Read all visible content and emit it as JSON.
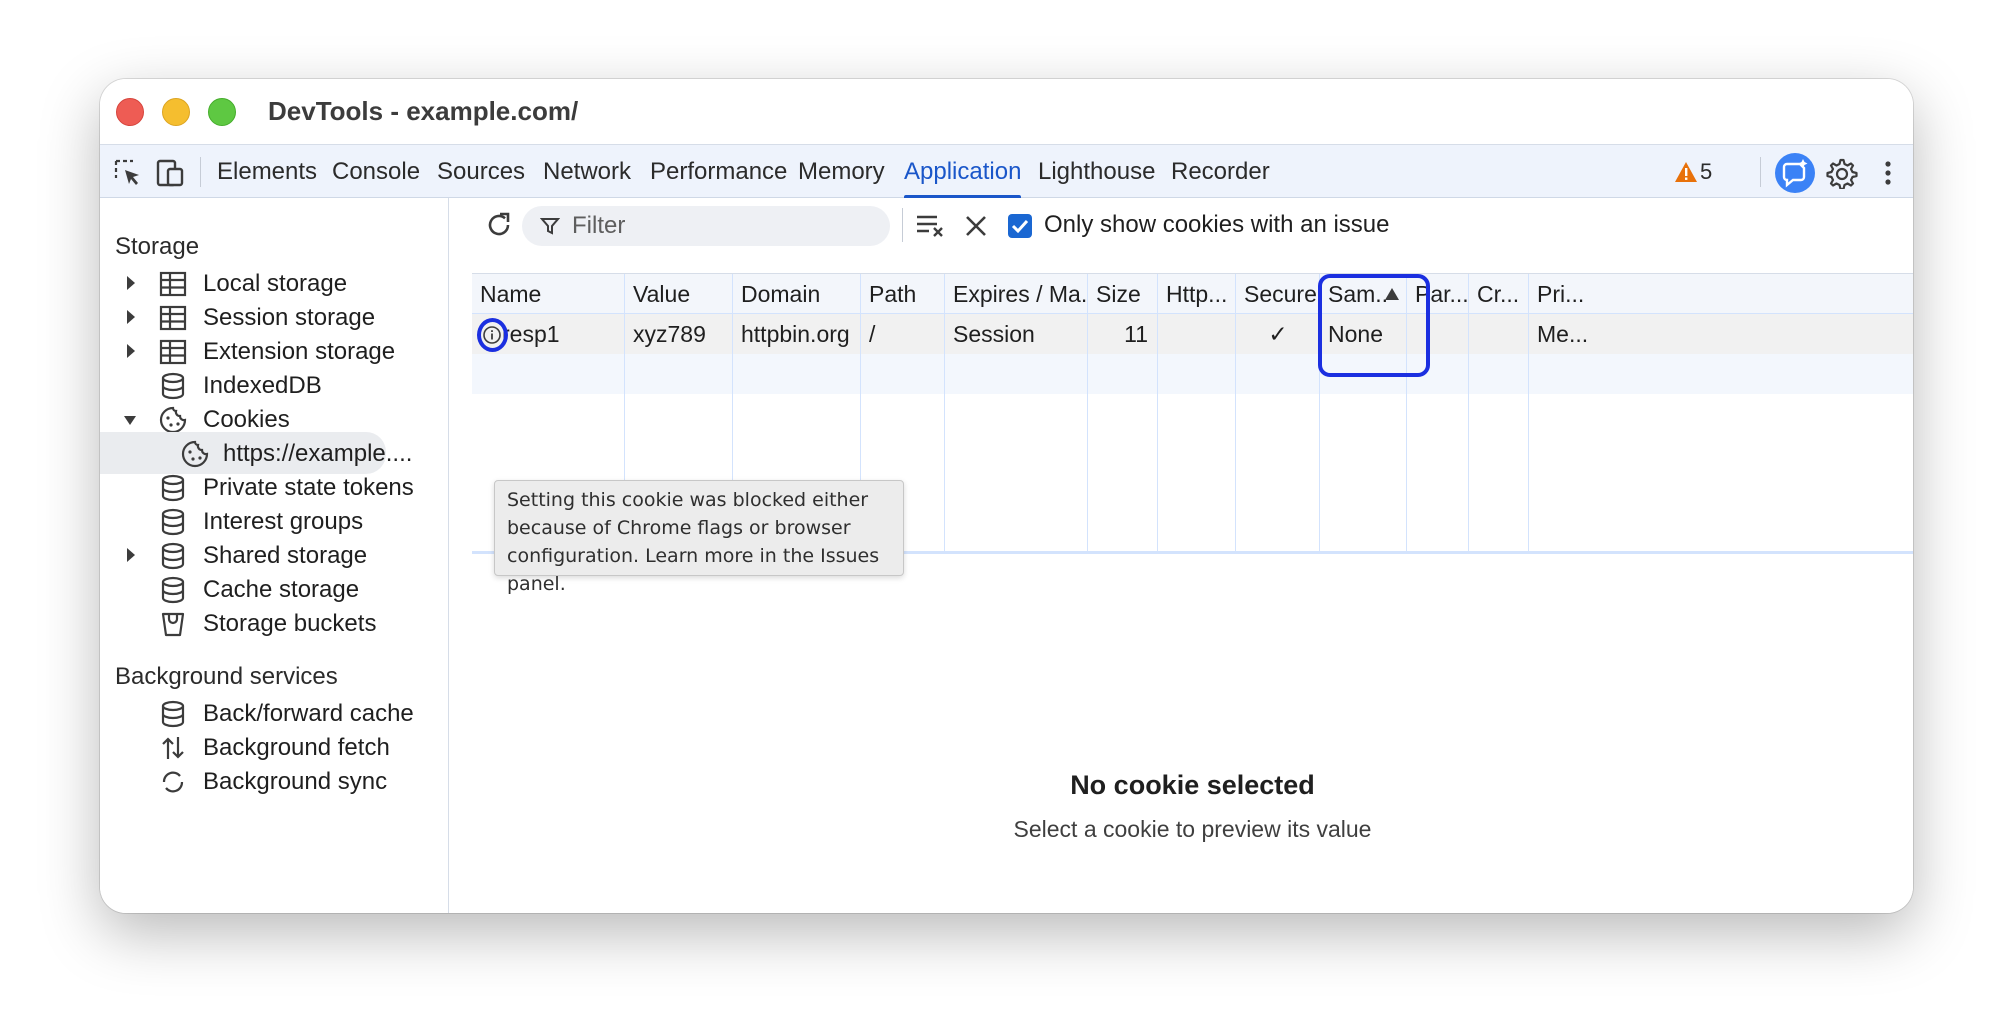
{
  "window": {
    "title": "DevTools - example.com/"
  },
  "tabs": [
    {
      "label": "Elements"
    },
    {
      "label": "Console"
    },
    {
      "label": "Sources"
    },
    {
      "label": "Network"
    },
    {
      "label": "Performance"
    },
    {
      "label": "Memory"
    },
    {
      "label": "Application"
    },
    {
      "label": "Lighthouse"
    },
    {
      "label": "Recorder"
    }
  ],
  "active_tab": "Application",
  "issues": {
    "count": "5"
  },
  "sidebar": {
    "storage_title": "Storage",
    "storage_items": [
      {
        "label": "Local storage",
        "icon": "table-icon",
        "expandable": true
      },
      {
        "label": "Session storage",
        "icon": "table-icon",
        "expandable": true
      },
      {
        "label": "Extension storage",
        "icon": "table-icon",
        "expandable": true
      },
      {
        "label": "IndexedDB",
        "icon": "database-icon",
        "expandable": false
      },
      {
        "label": "Cookies",
        "icon": "cookie-icon",
        "expandable": true,
        "expanded": true
      },
      {
        "label": "https://example....",
        "icon": "cookie-icon",
        "child": true,
        "selected": true
      },
      {
        "label": "Private state tokens",
        "icon": "database-icon",
        "expandable": false
      },
      {
        "label": "Interest groups",
        "icon": "database-icon",
        "expandable": false
      },
      {
        "label": "Shared storage",
        "icon": "database-icon",
        "expandable": true
      },
      {
        "label": "Cache storage",
        "icon": "database-icon",
        "expandable": false
      },
      {
        "label": "Storage buckets",
        "icon": "bucket-icon",
        "expandable": false
      }
    ],
    "background_title": "Background services",
    "background_items": [
      {
        "label": "Back/forward cache",
        "icon": "database-icon"
      },
      {
        "label": "Background fetch",
        "icon": "arrows-updown-icon"
      },
      {
        "label": "Background sync",
        "icon": "sync-icon"
      }
    ]
  },
  "toolbar": {
    "filter_placeholder": "Filter",
    "only_issues_label": "Only show cookies with an issue",
    "only_issues_checked": true
  },
  "cookies_table": {
    "columns": [
      "Name",
      "Value",
      "Domain",
      "Path",
      "Expires / Ma...",
      "Size",
      "Http...",
      "Secure",
      "Sam...",
      "Par...",
      "Cr...",
      "Pri..."
    ],
    "rows": [
      [
        "resp1",
        "xyz789",
        "httpbin.org",
        "/",
        "Session",
        "11",
        "",
        "✓",
        "None",
        "",
        "",
        "Me..."
      ]
    ],
    "sort_column": "Sam...",
    "sort_direction": "ascending"
  },
  "tooltip": {
    "text": "Setting this cookie was blocked either because of Chrome flags or browser configuration. Learn more in the Issues panel."
  },
  "preview": {
    "title": "No cookie selected",
    "subtitle": "Select a cookie to preview its value"
  },
  "colors": {
    "accent": "#1a56c9",
    "highlight": "#1b2fe0",
    "warning": "#e8710a"
  }
}
